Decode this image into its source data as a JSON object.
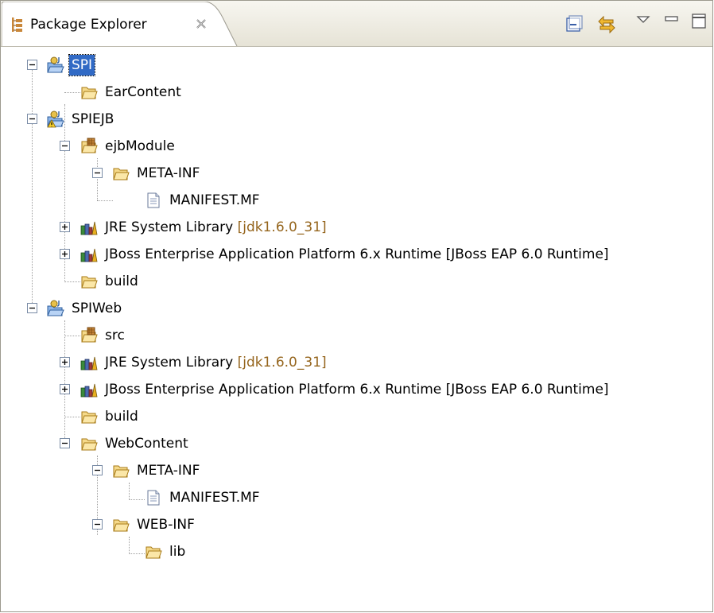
{
  "view": {
    "title": "Package Explorer",
    "toolbar": {
      "collapse_all": "collapse-all-icon",
      "link_editor": "link-with-editor-icon",
      "view_menu": "view-menu-icon",
      "minimize": "minimize-icon",
      "maximize": "maximize-icon"
    }
  },
  "tree": {
    "spi": "SPI",
    "ear_content": "EarContent",
    "spiejb": "SPIEJB",
    "ejb_module": "ejbModule",
    "ejb_meta_inf": "META-INF",
    "ejb_manifest": "MANIFEST.MF",
    "ejb_jre": "JRE System Library",
    "ejb_jre_deco": "[jdk1.6.0_31]",
    "ejb_jboss": "JBoss Enterprise Application Platform 6.x Runtime [JBoss EAP 6.0 Runtime]",
    "ejb_build": "build",
    "spiweb": "SPIWeb",
    "web_src": "src",
    "web_jre": "JRE System Library",
    "web_jre_deco": "[jdk1.6.0_31]",
    "web_jboss": "JBoss Enterprise Application Platform 6.x Runtime [JBoss EAP 6.0 Runtime]",
    "web_build": "build",
    "web_content": "WebContent",
    "web_meta_inf": "META-INF",
    "web_manifest": "MANIFEST.MF",
    "web_inf": "WEB-INF",
    "web_lib": "lib"
  }
}
